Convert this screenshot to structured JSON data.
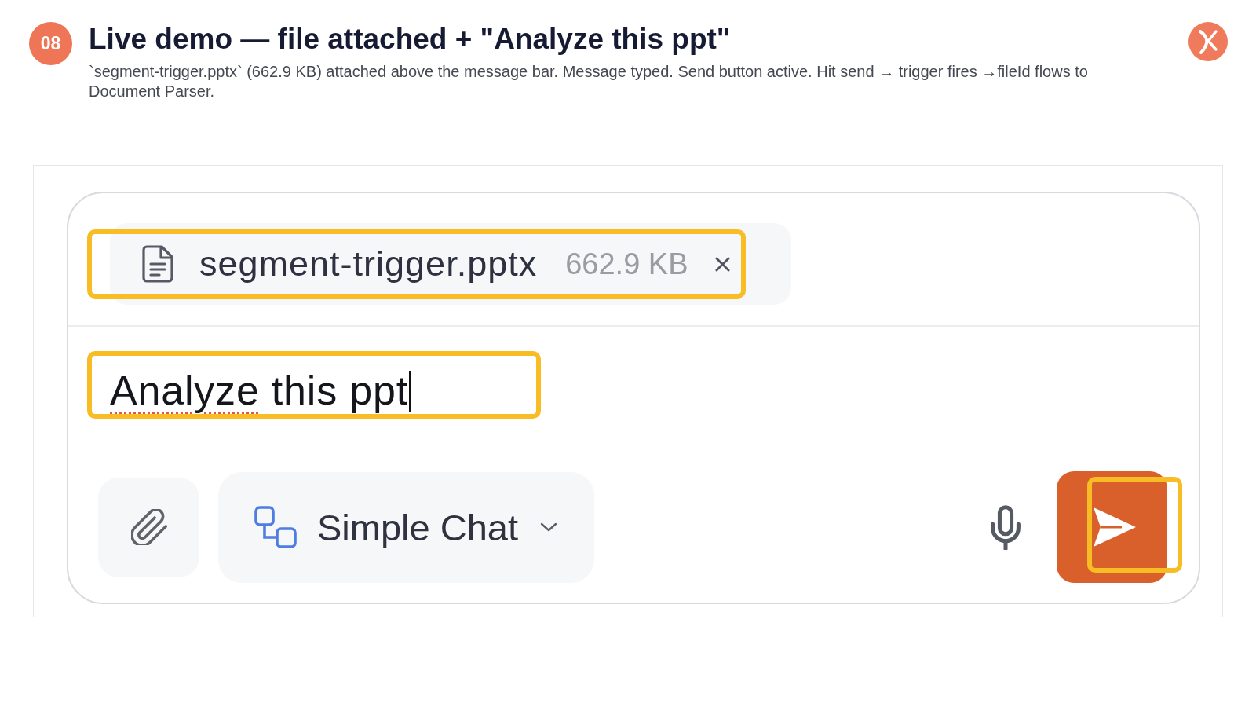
{
  "slide": {
    "number": "08",
    "title": "Live demo — file attached + \"Analyze this ppt\"",
    "description": "`segment-trigger.pptx` (662.9 KB) attached above the message bar. Message typed. Send button active. Hit send → trigger fires →fileId flows to Document Parser."
  },
  "composer": {
    "attachment": {
      "file_name": "segment-trigger.pptx",
      "file_size": "662.9 KB",
      "highlighted": true
    },
    "message": {
      "parts": [
        {
          "text": "Analyze",
          "misspelled": true
        },
        {
          "text": " this ppt",
          "misspelled": false
        }
      ],
      "focused": true,
      "highlighted": true
    },
    "mode_selector": {
      "label": "Simple Chat"
    },
    "send_button": {
      "active": true,
      "highlighted": true
    }
  }
}
